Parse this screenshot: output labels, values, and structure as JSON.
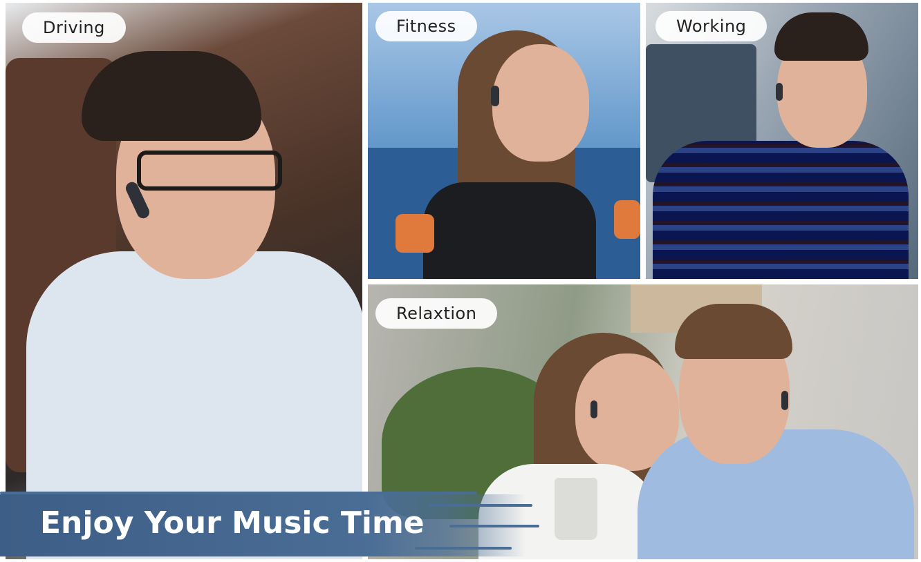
{
  "panels": {
    "driving": {
      "label": "Driving"
    },
    "fitness": {
      "label": "Fitness"
    },
    "working": {
      "label": "Working"
    },
    "relaxation": {
      "label": "Relaxtion"
    }
  },
  "banner": {
    "text": "Enjoy Your Music Time",
    "color": "#4a6d96"
  }
}
